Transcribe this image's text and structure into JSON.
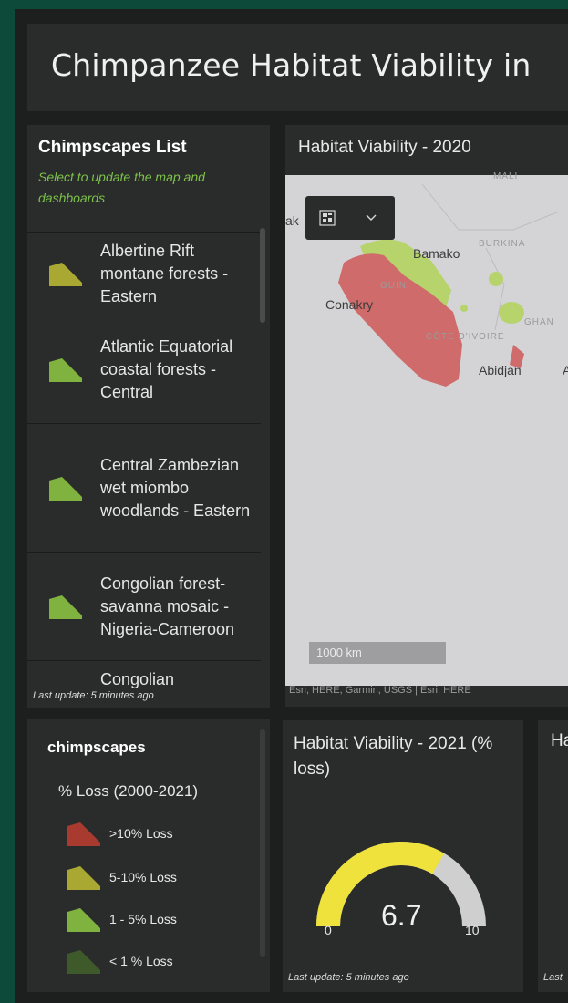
{
  "title": "Chimpanzee Habitat Viability in",
  "list": {
    "title": "Chimpscapes List",
    "subtitle": "Select to update the map and dashboards",
    "items": [
      {
        "label": "Albertine Rift montane forests - Eastern",
        "color": "#a9a832"
      },
      {
        "label": "Atlantic Equatorial coastal forests - Central",
        "color": "#7fb23f"
      },
      {
        "label": "Central Zambezian wet miombo woodlands - Eastern",
        "color": "#7fb23f"
      },
      {
        "label": "Congolian forest-savanna mosaic - Nigeria-Cameroon",
        "color": "#7fb23f"
      },
      {
        "label": "Congolian",
        "color": "#7fb23f"
      }
    ],
    "last_update": "Last update: 5 minutes ago"
  },
  "map": {
    "title": "Habitat Viability - 2020",
    "scale": "1000 km",
    "attribution": "Esri, HERE, Garmin, USGS | Esri, HERE",
    "labels": {
      "mali": "MALI",
      "burkina": "BURKINA",
      "bamako": "Bamako",
      "conakry": "Conakry",
      "guinea": "GUIN",
      "ghana": "GHAN",
      "cote": "CÔTE D'IVOIRE",
      "abidjan": "Abidjan",
      "accra": "A",
      "ak": "ak"
    },
    "region_colors": {
      "loss_high": "#cf6b6b",
      "loss_low": "#b7d36c"
    }
  },
  "legend": {
    "title": "chimpscapes",
    "subtitle": "% Loss (2000-2021)",
    "items": [
      {
        "label": ">10% Loss",
        "color": "#a83a30"
      },
      {
        "label": "5-10% Loss",
        "color": "#a9a832"
      },
      {
        "label": "1 - 5% Loss",
        "color": "#7fb23f"
      },
      {
        "label": "< 1 % Loss",
        "color": "#3f5a2a"
      }
    ]
  },
  "gauge": {
    "title": "Habitat Viability - 2021 (% loss)",
    "value": "6.7",
    "min": "0",
    "max": "10",
    "fraction": 0.67,
    "fill_color": "#f0e23c",
    "track_color": "#cfcfcf",
    "last_update": "Last update: 5 minutes ago"
  },
  "third": {
    "title": "Ha",
    "last_update": "Last"
  }
}
